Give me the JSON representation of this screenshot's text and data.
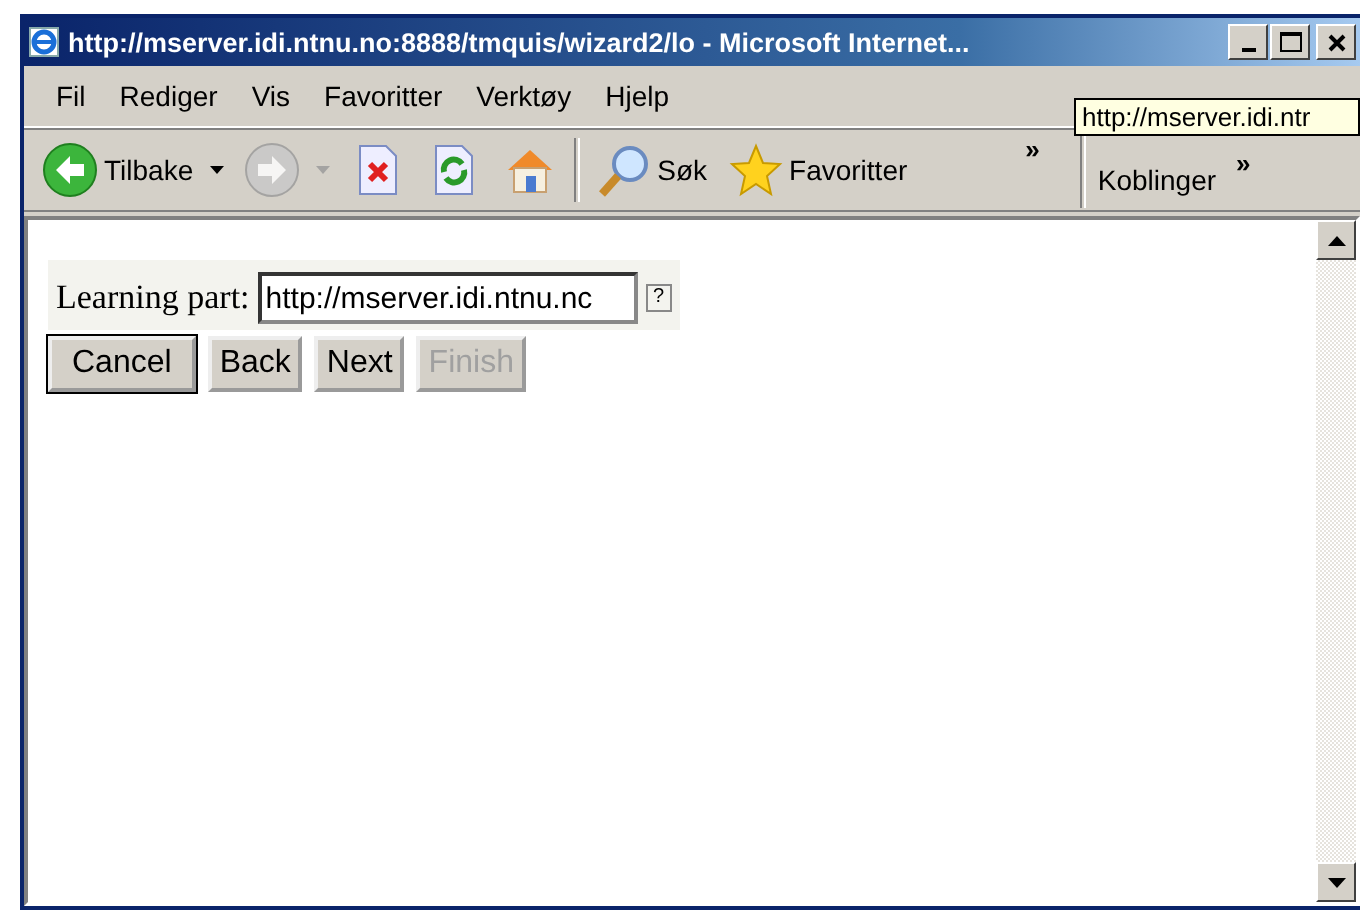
{
  "window": {
    "title": "http://mserver.idi.ntnu.no:8888/tmquis/wizard2/lo - Microsoft Internet...",
    "controls": [
      {
        "kind": "minimize"
      },
      {
        "kind": "maximize"
      },
      {
        "kind": "close"
      }
    ]
  },
  "menu": [
    {
      "label": "Fil"
    },
    {
      "label": "Rediger"
    },
    {
      "label": "Vis"
    },
    {
      "label": "Favoritter"
    },
    {
      "label": "Verktøy"
    },
    {
      "label": "Hjelp"
    }
  ],
  "tooltip": "http://mserver.idi.ntr",
  "toolbar": [
    {
      "kind": "back",
      "label": "Tilbake",
      "disabled": false,
      "dropdown": true
    },
    {
      "kind": "forward",
      "disabled": true,
      "dropdown": true
    },
    {
      "kind": "stop",
      "disabled": false
    },
    {
      "kind": "refresh",
      "disabled": false
    },
    {
      "kind": "home",
      "disabled": false
    },
    {
      "kind": "separator"
    },
    {
      "kind": "search",
      "label": "Søk",
      "disabled": false
    },
    {
      "kind": "favorites",
      "label": "Favoritter",
      "disabled": false
    },
    {
      "kind": "chevron",
      "label": "»"
    }
  ],
  "links": {
    "label": "Koblinger",
    "chevron": "»"
  },
  "form": {
    "field": {
      "label": "Learning part:",
      "value": "http://mserver.idi.ntnu.nc",
      "help": "?"
    },
    "buttons": [
      {
        "label": "Cancel",
        "default": true,
        "disabled": false
      },
      {
        "label": "Back",
        "default": false,
        "disabled": false
      },
      {
        "label": "Next",
        "default": false,
        "disabled": false
      },
      {
        "label": "Finish",
        "default": false,
        "disabled": true
      }
    ]
  }
}
